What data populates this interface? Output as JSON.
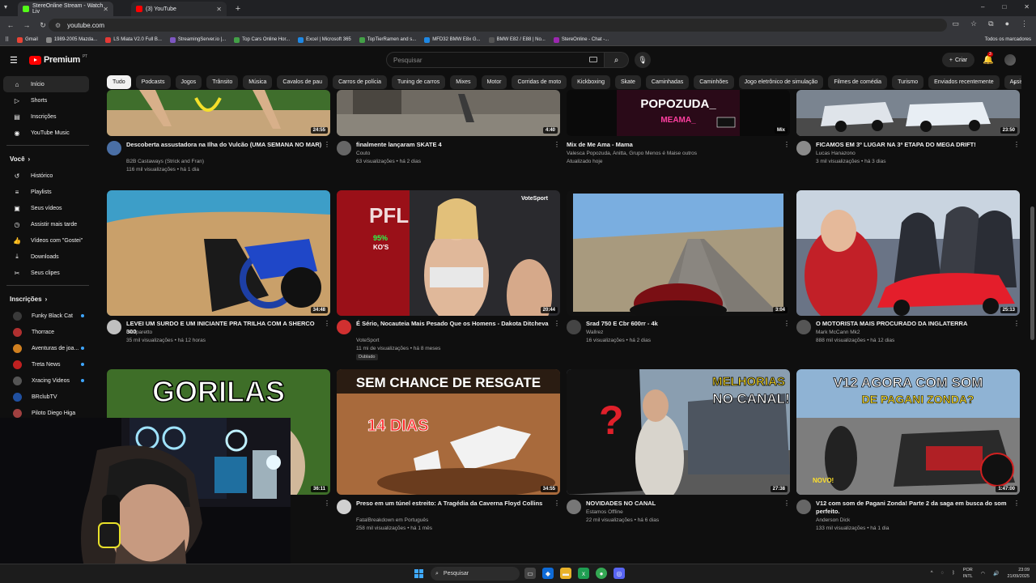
{
  "browser": {
    "tabs": [
      {
        "title": "StereOnline Stream - Watch Liv",
        "icon": "kick-icon",
        "color": "#53fc18"
      },
      {
        "title": "(3) YouTube",
        "icon": "youtube-icon",
        "color": "#ff0000"
      }
    ],
    "url": "youtube.com",
    "bookmarks": [
      {
        "label": "Gmail",
        "color": "#ea4335"
      },
      {
        "label": "1989-2005 Mazda...",
        "color": "#888888"
      },
      {
        "label": "LS Miata V2.0 Full B...",
        "color": "#e53935"
      },
      {
        "label": "StreamingServer.io |...",
        "color": "#7e57c2"
      },
      {
        "label": "Top Cars Online Hor...",
        "color": "#43a047"
      },
      {
        "label": "Excel | Microsoft 365",
        "color": "#1e88e5"
      },
      {
        "label": "TopTierRamen and s...",
        "color": "#43a047"
      },
      {
        "label": "MFD32 BMW E8x G...",
        "color": "#1e88e5"
      },
      {
        "label": "BMW E82 / E88 | No...",
        "color": "#555555"
      },
      {
        "label": "StereOnline - Chat -...",
        "color": "#9c27b0"
      }
    ],
    "all_bookmarks": "Todos os marcadores"
  },
  "youtube": {
    "logo": "Premium",
    "logo_sup": "PT",
    "search_placeholder": "Pesquisar",
    "create_label": "Criar",
    "notif_count": "3",
    "chips": [
      "Tudo",
      "Podcasts",
      "Jogos",
      "Trânsito",
      "Música",
      "Cavalos de pau",
      "Carros de polícia",
      "Tuning de carros",
      "Mixes",
      "Motor",
      "Corridas de moto",
      "Kickboxing",
      "Skate",
      "Caminhadas",
      "Caminhões",
      "Jogo eletrônico de simulação",
      "Filmes de comédia",
      "Turismo",
      "Enviados recentemente",
      "Assistidos"
    ],
    "sidebar": {
      "main": [
        {
          "label": "Início",
          "icon": "home-icon",
          "glyph": "⌂"
        },
        {
          "label": "Shorts",
          "icon": "shorts-icon",
          "glyph": "▷"
        },
        {
          "label": "Inscrições",
          "icon": "subscriptions-icon",
          "glyph": "▤"
        },
        {
          "label": "YouTube Music",
          "icon": "music-icon",
          "glyph": "◉"
        }
      ],
      "you_title": "Você",
      "you": [
        {
          "label": "Histórico",
          "icon": "history-icon",
          "glyph": "↺"
        },
        {
          "label": "Playlists",
          "icon": "playlists-icon",
          "glyph": "≡"
        },
        {
          "label": "Seus vídeos",
          "icon": "your-videos-icon",
          "glyph": "▣"
        },
        {
          "label": "Assistir mais tarde",
          "icon": "watch-later-icon",
          "glyph": "◷"
        },
        {
          "label": "Vídeos com \"Gostei\"",
          "icon": "liked-icon",
          "glyph": "👍"
        },
        {
          "label": "Downloads",
          "icon": "downloads-icon",
          "glyph": "⤓"
        },
        {
          "label": "Seus clipes",
          "icon": "clips-icon",
          "glyph": "✂"
        }
      ],
      "subs_title": "Inscrições",
      "subs": [
        {
          "label": "Funky Black Cat",
          "color": "#3a3a3a"
        },
        {
          "label": "Thorrace",
          "color": "#b03030"
        },
        {
          "label": "Aventuras de joa...",
          "color": "#d08020"
        },
        {
          "label": "Treta News",
          "color": "#c02020"
        },
        {
          "label": "Xracing Videos",
          "color": "#555555"
        },
        {
          "label": "BRclubTV",
          "color": "#2050a0"
        },
        {
          "label": "Piloto Diego Higa",
          "color": "#a04040"
        }
      ]
    },
    "videos": [
      {
        "title": "Descoberta assustadora na Ilha do Vulcão (UMA SEMANA NO MAR)",
        "channel": "B2B Castaways (Strick and Fran)",
        "meta": "116 mil visualizações • há 1 dia",
        "duration": "24:55",
        "avatar": "#4a6fa5"
      },
      {
        "title": "finalmente lançaram SKATE 4",
        "channel": "Couto",
        "meta": "63 visualizações • há 2 dias",
        "duration": "4:40",
        "avatar": "#666666"
      },
      {
        "title": "Mix de Me Ama - Mama",
        "channel": "Valesca Popozuda, Anitta, Grupo Menos é Maise outros",
        "meta": "Atualizado hoje",
        "duration": "Mix",
        "avatar": ""
      },
      {
        "title": "FICAMOS EM 3º LUGAR NA 3ª ETAPA DO MEGA DRIFT!",
        "channel": "Lucas Hanazono",
        "meta": "3 mil visualizações • há 3 dias",
        "duration": "23:50",
        "avatar": "#8a8a8a"
      },
      {
        "title": "LEVEI UM SURDO E UM INICIANTE PRA TRILHA COM A SHERCO 300",
        "channel": "Gasparetto",
        "meta": "35 mil visualizações • há 12 horas",
        "duration": "34:48",
        "avatar": "#c0c0c0"
      },
      {
        "title": "É Sério, Nocauteia Mais Pesado Que os Homens - Dakota Ditcheva",
        "channel": "VoteSport",
        "meta": "11 mi de visualizações • há 8 meses",
        "duration": "20:44",
        "avatar": "#d03030",
        "badge": "Dublado"
      },
      {
        "title": "Srad 750 E Cbr 600rr - 4k",
        "channel": "Wallrez",
        "meta": "16 visualizações • há 2 dias",
        "duration": "3:04",
        "avatar": "#444444"
      },
      {
        "title": "O MOTORISTA MAIS PROCURADO DA INGLATERRA",
        "channel": "Mark McCann Mk2",
        "meta": "888 mil visualizações • há 12 dias",
        "duration": "25:13",
        "avatar": "#555555"
      },
      {
        "title": "GORILAS",
        "channel": "",
        "meta": "",
        "duration": "36:11",
        "avatar": "#3a7030"
      },
      {
        "title": "Preso em um túnel estreito: A Tragédia da Caverna Floyd Collins",
        "channel": "FatalBreakdown em Português",
        "meta": "258 mil visualizações • há 1 mês",
        "duration": "34:55",
        "avatar": "#d0d0d0"
      },
      {
        "title": "NOVIDADES NO CANAL",
        "channel": "Estamos Offline",
        "meta": "22 mil visualizações • há 6 dias",
        "duration": "27:38",
        "avatar": "#777777"
      },
      {
        "title": "V12 com som de Pagani Zonda! Parte 2 da saga em busca do som perfeito.",
        "channel": "Anderson Dick",
        "meta": "133 mil visualizações • há 1 dia",
        "duration": "1:47:00",
        "avatar": "#666666"
      }
    ],
    "thumb_text": {
      "popozuda": "POPOZUDA",
      "meama": "Me Ama - Mama",
      "ko": "95%",
      "kos": "KO'S",
      "votesport": "VoteSport",
      "gorilas": "GORILAS",
      "resgate": "SEM CHANCE DE RESGATE",
      "dias": "14 DIAS",
      "melhorias": "MELHORIAS",
      "nocanal": "NO CANAL!",
      "v12": "V12 AGORA COM SOM",
      "pagani": "DE PAGANI ZONDA?",
      "novo": "NOVO!"
    }
  },
  "taskbar": {
    "search": "Pesquisar",
    "lang1": "POR",
    "lang2": "INTL",
    "time": "23:09",
    "date": "21/09/2025"
  }
}
